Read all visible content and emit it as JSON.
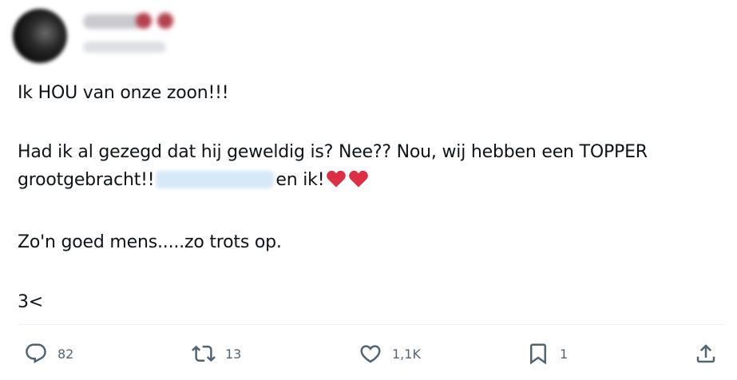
{
  "tweet": {
    "lines": {
      "line1": "Ik HOU van onze zoon!!!",
      "line2": "Had ik al gezegd dat hij geweldig is?  Nee?? Nou, wij hebben een TOPPER",
      "line3_before": "grootgebracht!!",
      "line3_after": "en ik!",
      "line4": "Zo'n goed mens.....zo trots op.",
      "line5": "3<"
    },
    "hearts": [
      "heart-emoji",
      "heart-emoji"
    ]
  },
  "actions": {
    "reply": {
      "icon": "reply-icon",
      "count": "82"
    },
    "retweet": {
      "icon": "retweet-icon",
      "count": "13"
    },
    "like": {
      "icon": "heart-icon",
      "count": "1,1K"
    },
    "bookmark": {
      "icon": "bookmark-icon",
      "count": "1"
    },
    "share": {
      "icon": "share-icon"
    }
  },
  "colors": {
    "text": "#0f1419",
    "secondary": "#536471",
    "heart_emoji": "#dd2e44",
    "divider": "#eff3f4"
  }
}
